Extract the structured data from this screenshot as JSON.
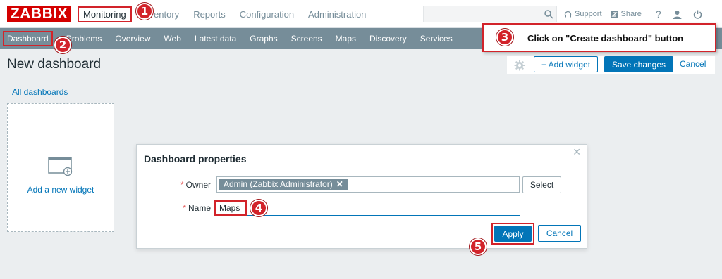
{
  "logo": {
    "text": "ZABBIX"
  },
  "main_menu": {
    "monitoring": "Monitoring",
    "inventory": "Inventory",
    "reports": "Reports",
    "configuration": "Configuration",
    "administration": "Administration"
  },
  "top_right": {
    "support": "Support",
    "share": "Share",
    "help": "?"
  },
  "sub_menu": [
    "Dashboard",
    "Problems",
    "Overview",
    "Web",
    "Latest data",
    "Graphs",
    "Screens",
    "Maps",
    "Discovery",
    "Services"
  ],
  "header": {
    "title": "New dashboard",
    "add_widget": "+ Add widget",
    "save_changes": "Save changes",
    "cancel": "Cancel"
  },
  "all_dashboards": "All dashboards",
  "widget": {
    "label": "Add a new widget"
  },
  "callout": {
    "step": "3",
    "text": "Click on \"Create dashboard\" button"
  },
  "dialog": {
    "title": "Dashboard properties",
    "owner_label": "Owner",
    "owner_value": "Admin (Zabbix Administrator)",
    "select_label": "Select",
    "name_label": "Name",
    "name_value": "Maps",
    "apply_label": "Apply",
    "cancel_label": "Cancel",
    "required_mark": "*"
  },
  "steps": {
    "s1": "1",
    "s2": "2",
    "s4": "4",
    "s5": "5"
  },
  "colors": {
    "accent": "#0275b8",
    "brand": "#d40000",
    "highlight": "#d2232a",
    "subnav": "#768d99"
  }
}
